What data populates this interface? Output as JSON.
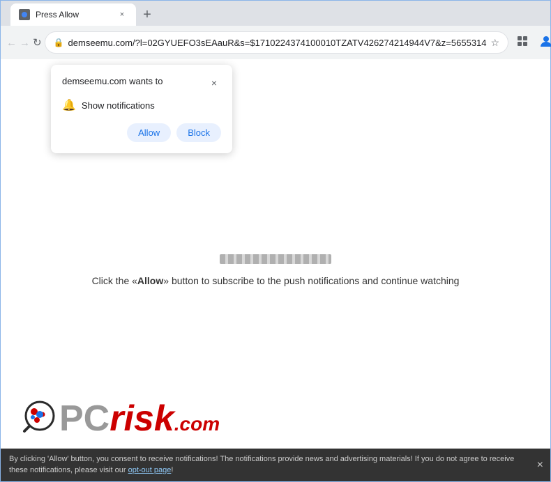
{
  "browser": {
    "tab_title": "Press Allow",
    "url": "demseemu.com/?l=02GYUEFO3sEAauR&s=$171022437410001 0TZATV426274214944V7&z=5655314",
    "full_url": "demseemu.com/?l=02GYUEFO3sEAauR&s=$1710224374100010TZATV426274214944V7&z=5655314"
  },
  "nav": {
    "back_label": "←",
    "forward_label": "→",
    "reload_label": "↻",
    "star_label": "☆",
    "extensions_label": "⊞",
    "profile_label": "👤",
    "menu_label": "⋮"
  },
  "popup": {
    "title": "demseemu.com wants to",
    "close_label": "×",
    "notification_row_label": "Show notifications",
    "allow_label": "Allow",
    "block_label": "Block"
  },
  "page": {
    "instruction_text_prefix": "Click the «",
    "instruction_allow_word": "Allow",
    "instruction_text_suffix": "» button to subscribe to the push notifications and continue watching"
  },
  "consent_bar": {
    "text": "By clicking 'Allow' button, you consent to receive notifications! The notifications provide news and advertising materials! If you do not agree to receive these notifications, please visit our ",
    "link_text": "opt-out page",
    "text_suffix": "!"
  }
}
